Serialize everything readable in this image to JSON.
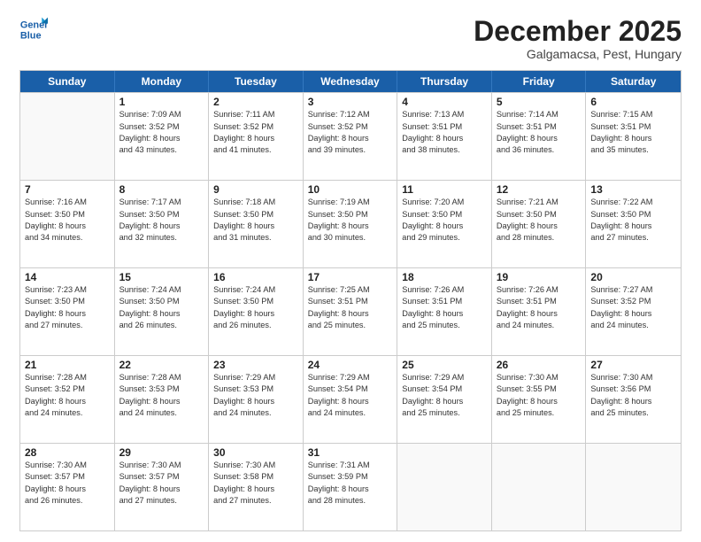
{
  "logo": {
    "line1": "General",
    "line2": "Blue"
  },
  "title": "December 2025",
  "subtitle": "Galgamacsa, Pest, Hungary",
  "weekdays": [
    "Sunday",
    "Monday",
    "Tuesday",
    "Wednesday",
    "Thursday",
    "Friday",
    "Saturday"
  ],
  "weeks": [
    [
      {
        "day": "",
        "sunrise": "",
        "sunset": "",
        "daylight": ""
      },
      {
        "day": "1",
        "sunrise": "Sunrise: 7:09 AM",
        "sunset": "Sunset: 3:52 PM",
        "daylight": "Daylight: 8 hours and 43 minutes."
      },
      {
        "day": "2",
        "sunrise": "Sunrise: 7:11 AM",
        "sunset": "Sunset: 3:52 PM",
        "daylight": "Daylight: 8 hours and 41 minutes."
      },
      {
        "day": "3",
        "sunrise": "Sunrise: 7:12 AM",
        "sunset": "Sunset: 3:52 PM",
        "daylight": "Daylight: 8 hours and 39 minutes."
      },
      {
        "day": "4",
        "sunrise": "Sunrise: 7:13 AM",
        "sunset": "Sunset: 3:51 PM",
        "daylight": "Daylight: 8 hours and 38 minutes."
      },
      {
        "day": "5",
        "sunrise": "Sunrise: 7:14 AM",
        "sunset": "Sunset: 3:51 PM",
        "daylight": "Daylight: 8 hours and 36 minutes."
      },
      {
        "day": "6",
        "sunrise": "Sunrise: 7:15 AM",
        "sunset": "Sunset: 3:51 PM",
        "daylight": "Daylight: 8 hours and 35 minutes."
      }
    ],
    [
      {
        "day": "7",
        "sunrise": "Sunrise: 7:16 AM",
        "sunset": "Sunset: 3:50 PM",
        "daylight": "Daylight: 8 hours and 34 minutes."
      },
      {
        "day": "8",
        "sunrise": "Sunrise: 7:17 AM",
        "sunset": "Sunset: 3:50 PM",
        "daylight": "Daylight: 8 hours and 32 minutes."
      },
      {
        "day": "9",
        "sunrise": "Sunrise: 7:18 AM",
        "sunset": "Sunset: 3:50 PM",
        "daylight": "Daylight: 8 hours and 31 minutes."
      },
      {
        "day": "10",
        "sunrise": "Sunrise: 7:19 AM",
        "sunset": "Sunset: 3:50 PM",
        "daylight": "Daylight: 8 hours and 30 minutes."
      },
      {
        "day": "11",
        "sunrise": "Sunrise: 7:20 AM",
        "sunset": "Sunset: 3:50 PM",
        "daylight": "Daylight: 8 hours and 29 minutes."
      },
      {
        "day": "12",
        "sunrise": "Sunrise: 7:21 AM",
        "sunset": "Sunset: 3:50 PM",
        "daylight": "Daylight: 8 hours and 28 minutes."
      },
      {
        "day": "13",
        "sunrise": "Sunrise: 7:22 AM",
        "sunset": "Sunset: 3:50 PM",
        "daylight": "Daylight: 8 hours and 27 minutes."
      }
    ],
    [
      {
        "day": "14",
        "sunrise": "Sunrise: 7:23 AM",
        "sunset": "Sunset: 3:50 PM",
        "daylight": "Daylight: 8 hours and 27 minutes."
      },
      {
        "day": "15",
        "sunrise": "Sunrise: 7:24 AM",
        "sunset": "Sunset: 3:50 PM",
        "daylight": "Daylight: 8 hours and 26 minutes."
      },
      {
        "day": "16",
        "sunrise": "Sunrise: 7:24 AM",
        "sunset": "Sunset: 3:50 PM",
        "daylight": "Daylight: 8 hours and 26 minutes."
      },
      {
        "day": "17",
        "sunrise": "Sunrise: 7:25 AM",
        "sunset": "Sunset: 3:51 PM",
        "daylight": "Daylight: 8 hours and 25 minutes."
      },
      {
        "day": "18",
        "sunrise": "Sunrise: 7:26 AM",
        "sunset": "Sunset: 3:51 PM",
        "daylight": "Daylight: 8 hours and 25 minutes."
      },
      {
        "day": "19",
        "sunrise": "Sunrise: 7:26 AM",
        "sunset": "Sunset: 3:51 PM",
        "daylight": "Daylight: 8 hours and 24 minutes."
      },
      {
        "day": "20",
        "sunrise": "Sunrise: 7:27 AM",
        "sunset": "Sunset: 3:52 PM",
        "daylight": "Daylight: 8 hours and 24 minutes."
      }
    ],
    [
      {
        "day": "21",
        "sunrise": "Sunrise: 7:28 AM",
        "sunset": "Sunset: 3:52 PM",
        "daylight": "Daylight: 8 hours and 24 minutes."
      },
      {
        "day": "22",
        "sunrise": "Sunrise: 7:28 AM",
        "sunset": "Sunset: 3:53 PM",
        "daylight": "Daylight: 8 hours and 24 minutes."
      },
      {
        "day": "23",
        "sunrise": "Sunrise: 7:29 AM",
        "sunset": "Sunset: 3:53 PM",
        "daylight": "Daylight: 8 hours and 24 minutes."
      },
      {
        "day": "24",
        "sunrise": "Sunrise: 7:29 AM",
        "sunset": "Sunset: 3:54 PM",
        "daylight": "Daylight: 8 hours and 24 minutes."
      },
      {
        "day": "25",
        "sunrise": "Sunrise: 7:29 AM",
        "sunset": "Sunset: 3:54 PM",
        "daylight": "Daylight: 8 hours and 25 minutes."
      },
      {
        "day": "26",
        "sunrise": "Sunrise: 7:30 AM",
        "sunset": "Sunset: 3:55 PM",
        "daylight": "Daylight: 8 hours and 25 minutes."
      },
      {
        "day": "27",
        "sunrise": "Sunrise: 7:30 AM",
        "sunset": "Sunset: 3:56 PM",
        "daylight": "Daylight: 8 hours and 25 minutes."
      }
    ],
    [
      {
        "day": "28",
        "sunrise": "Sunrise: 7:30 AM",
        "sunset": "Sunset: 3:57 PM",
        "daylight": "Daylight: 8 hours and 26 minutes."
      },
      {
        "day": "29",
        "sunrise": "Sunrise: 7:30 AM",
        "sunset": "Sunset: 3:57 PM",
        "daylight": "Daylight: 8 hours and 27 minutes."
      },
      {
        "day": "30",
        "sunrise": "Sunrise: 7:30 AM",
        "sunset": "Sunset: 3:58 PM",
        "daylight": "Daylight: 8 hours and 27 minutes."
      },
      {
        "day": "31",
        "sunrise": "Sunrise: 7:31 AM",
        "sunset": "Sunset: 3:59 PM",
        "daylight": "Daylight: 8 hours and 28 minutes."
      },
      {
        "day": "",
        "sunrise": "",
        "sunset": "",
        "daylight": ""
      },
      {
        "day": "",
        "sunrise": "",
        "sunset": "",
        "daylight": ""
      },
      {
        "day": "",
        "sunrise": "",
        "sunset": "",
        "daylight": ""
      }
    ]
  ]
}
